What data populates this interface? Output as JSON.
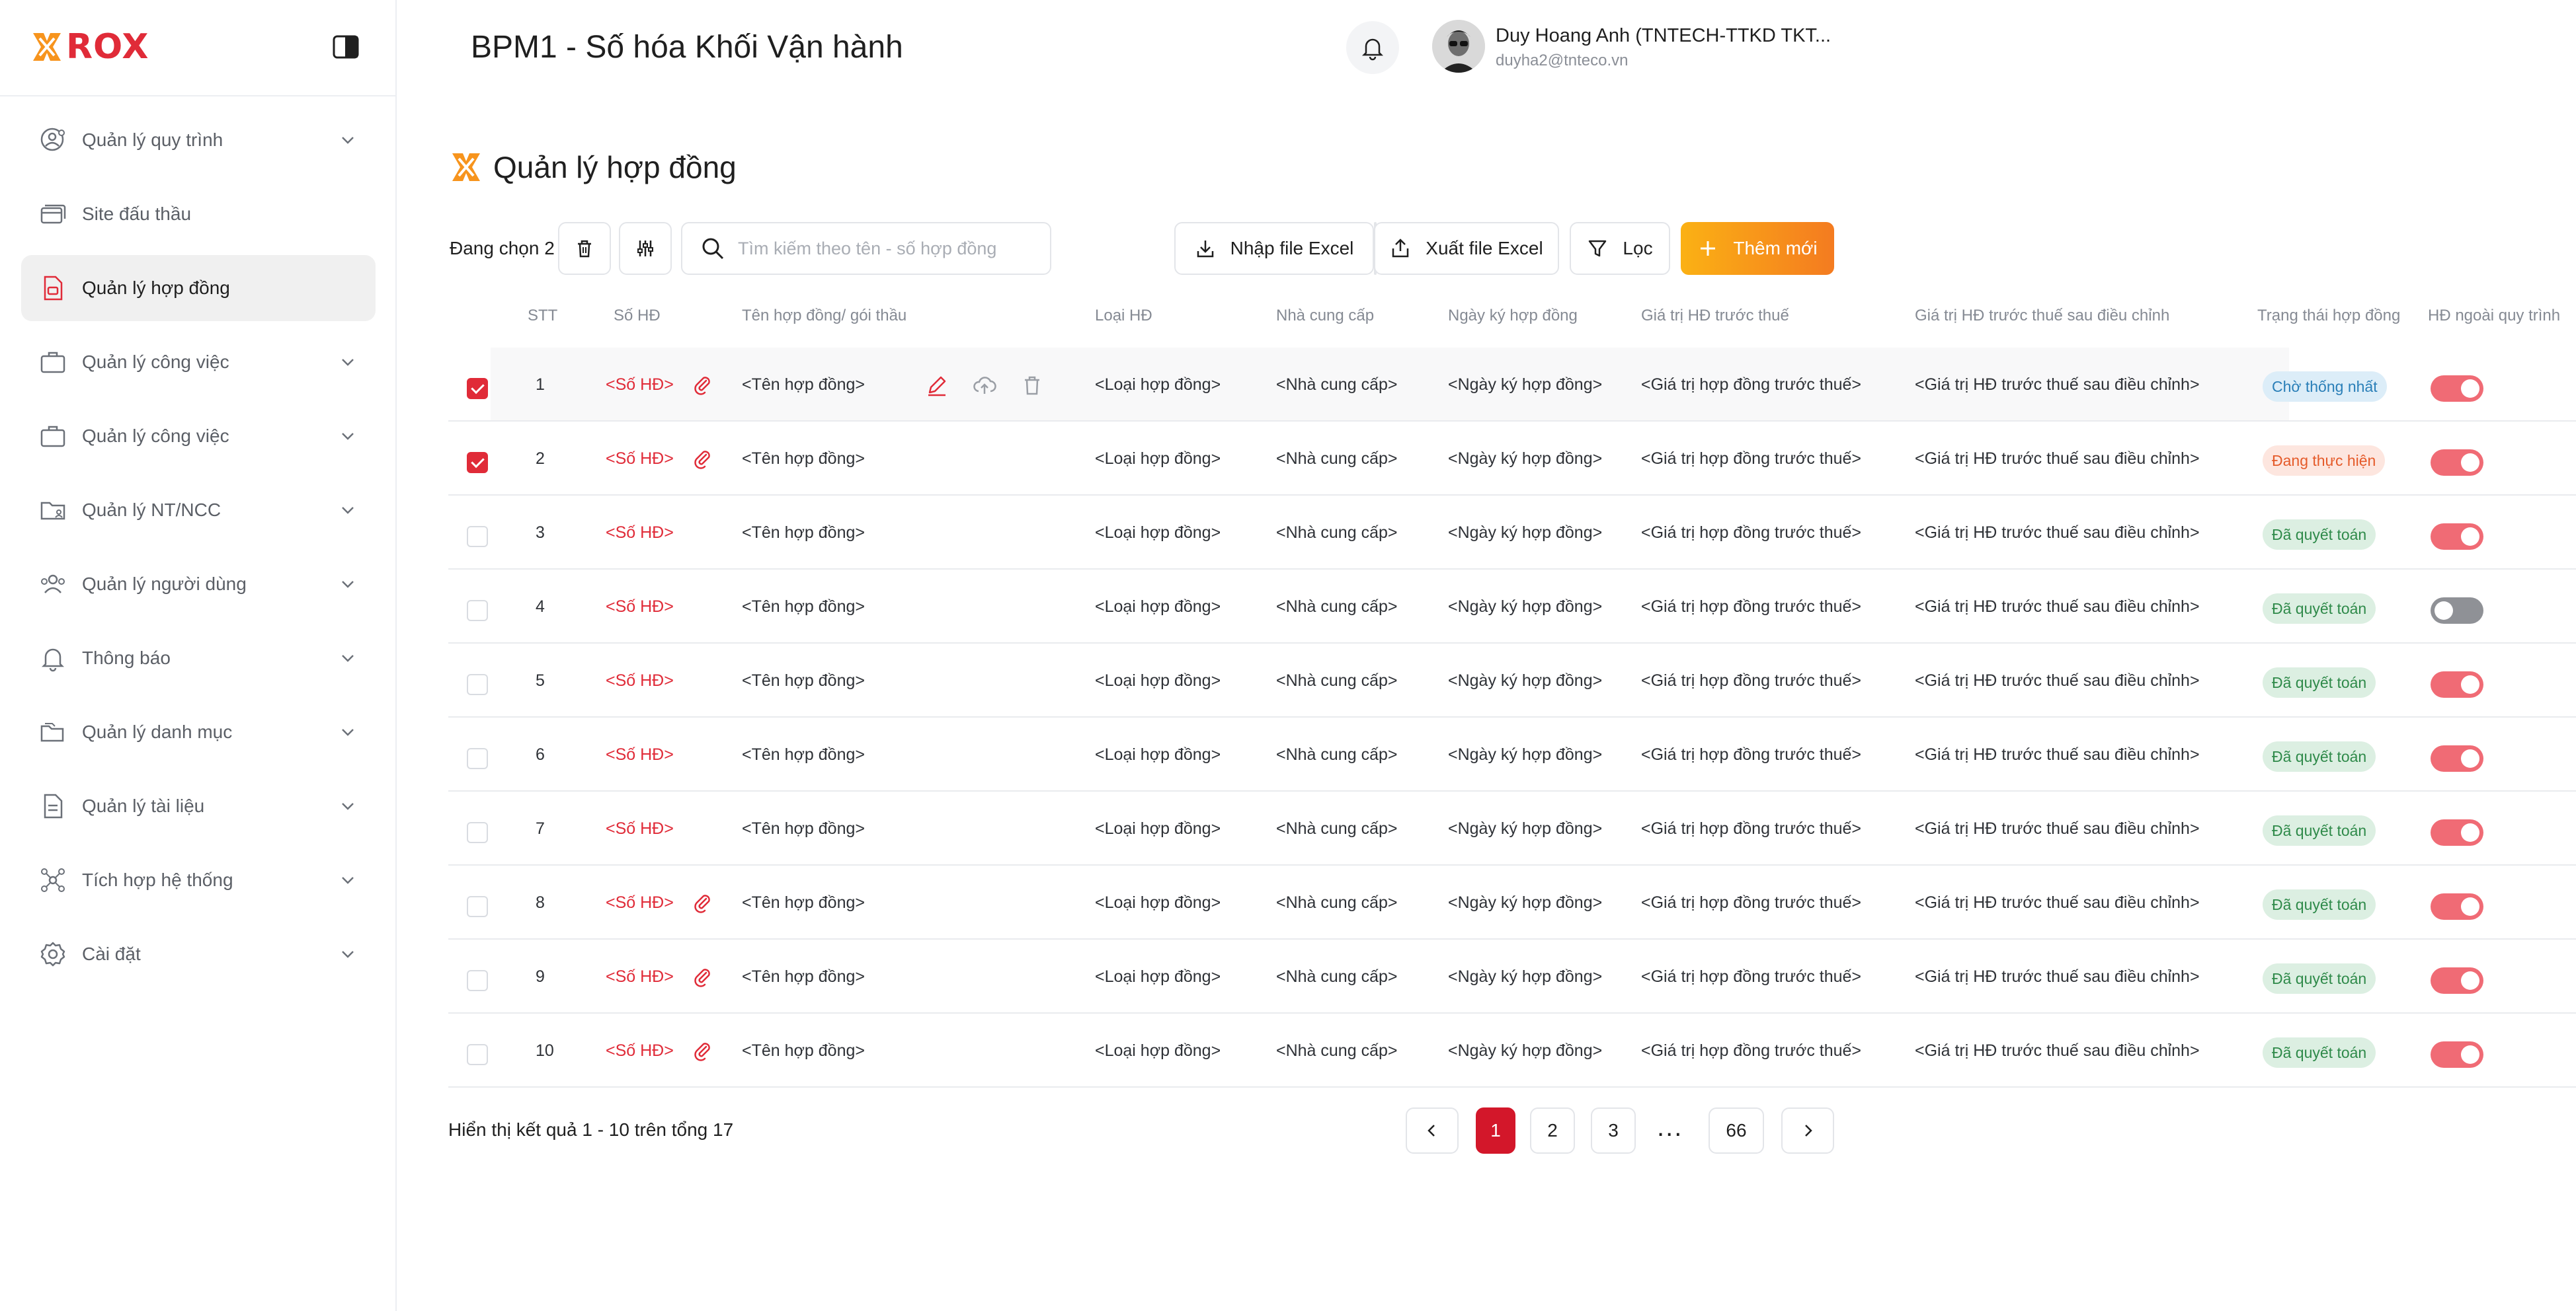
{
  "brand": {
    "name": "ROX",
    "color": "#e02b38"
  },
  "sidebar": {
    "items": [
      {
        "label": "Quản lý quy trình",
        "icon": "user-settings-icon",
        "has_chevron": true
      },
      {
        "label": "Site đấu thầu",
        "icon": "cards-icon",
        "has_chevron": false
      },
      {
        "label": "Quản lý hợp đồng",
        "icon": "contract-file-icon",
        "has_chevron": false,
        "active": true
      },
      {
        "label": "Quản lý công việc",
        "icon": "briefcase-icon",
        "has_chevron": true
      },
      {
        "label": "Quản lý công việc",
        "icon": "briefcase-icon",
        "has_chevron": true
      },
      {
        "label": "Quản lý NT/NCC",
        "icon": "folder-user-icon",
        "has_chevron": true
      },
      {
        "label": "Quản lý người dùng",
        "icon": "users-icon",
        "has_chevron": true
      },
      {
        "label": "Thông báo",
        "icon": "bell-icon",
        "has_chevron": true
      },
      {
        "label": "Quản lý danh mục",
        "icon": "folders-icon",
        "has_chevron": true
      },
      {
        "label": "Quản lý tài liệu",
        "icon": "document-icon",
        "has_chevron": true
      },
      {
        "label": "Tích hợp hệ thống",
        "icon": "integration-icon",
        "has_chevron": true
      },
      {
        "label": "Cài đặt",
        "icon": "gear-icon",
        "has_chevron": true
      }
    ]
  },
  "header": {
    "title": "BPM1 - Số hóa Khối Vận hành",
    "user_name": "Duy Hoang Anh (TNTECH-TTKD TKT...",
    "user_email": "duyha2@tnteco.vn"
  },
  "page": {
    "title": "Quản lý hợp đồng",
    "selected_text": "Đang chọn 2",
    "search_placeholder": "Tìm kiếm theo tên - số hợp đồng",
    "import_label": "Nhập file Excel",
    "export_label": "Xuất file Excel",
    "filter_label": "Lọc",
    "add_label": "Thêm mới"
  },
  "table": {
    "columns": [
      "STT",
      "Số HĐ",
      "Tên hợp đồng/ gói thầu",
      "Loại HĐ",
      "Nhà cung cấp",
      "Ngày ký hợp đồng",
      "Giá trị HĐ trước thuế",
      "Giá trị HĐ trước thuế sau điều chỉnh",
      "Trạng thái hợp đồng",
      "HĐ ngoài quy trình"
    ],
    "rows": [
      {
        "stt": "1",
        "so": "<Số HĐ>",
        "ten": "<Tên hợp đồng>",
        "loai": "<Loại hợp đồng>",
        "ncc": "<Nhà cung cấp>",
        "ngay": "<Ngày ký hợp đồng>",
        "gt": "<Giá trị hợp đồng trước thuế>",
        "gt_dc": "<Giá trị HĐ trước thuế sau điều chỉnh>",
        "status": "Chờ thống nhất",
        "status_type": "wait",
        "checked": true,
        "attach": true,
        "toggle": true,
        "actions": true
      },
      {
        "stt": "2",
        "so": "<Số HĐ>",
        "ten": "<Tên hợp đồng>",
        "loai": "<Loại hợp đồng>",
        "ncc": "<Nhà cung cấp>",
        "ngay": "<Ngày ký hợp đồng>",
        "gt": "<Giá trị hợp đồng trước thuế>",
        "gt_dc": "<Giá trị HĐ trước thuế sau điều chỉnh>",
        "status": "Đang thực hiện",
        "status_type": "doing",
        "checked": true,
        "attach": true,
        "toggle": true
      },
      {
        "stt": "3",
        "so": "<Số HĐ>",
        "ten": "<Tên hợp đồng>",
        "loai": "<Loại hợp đồng>",
        "ncc": "<Nhà cung cấp>",
        "ngay": "<Ngày ký hợp đồng>",
        "gt": "<Giá trị hợp đồng trước thuế>",
        "gt_dc": "<Giá trị HĐ trước thuế sau điều chỉnh>",
        "status": "Đã quyết toán",
        "status_type": "done",
        "checked": false,
        "attach": false,
        "toggle": true
      },
      {
        "stt": "4",
        "so": "<Số HĐ>",
        "ten": "<Tên hợp đồng>",
        "loai": "<Loại hợp đồng>",
        "ncc": "<Nhà cung cấp>",
        "ngay": "<Ngày ký hợp đồng>",
        "gt": "<Giá trị hợp đồng trước thuế>",
        "gt_dc": "<Giá trị HĐ trước thuế sau điều chỉnh>",
        "status": "Đã quyết toán",
        "status_type": "done",
        "checked": false,
        "attach": false,
        "toggle": false
      },
      {
        "stt": "5",
        "so": "<Số HĐ>",
        "ten": "<Tên hợp đồng>",
        "loai": "<Loại hợp đồng>",
        "ncc": "<Nhà cung cấp>",
        "ngay": "<Ngày ký hợp đồng>",
        "gt": "<Giá trị hợp đồng trước thuế>",
        "gt_dc": "<Giá trị HĐ trước thuế sau điều chỉnh>",
        "status": "Đã quyết toán",
        "status_type": "done",
        "checked": false,
        "attach": false,
        "toggle": true
      },
      {
        "stt": "6",
        "so": "<Số HĐ>",
        "ten": "<Tên hợp đồng>",
        "loai": "<Loại hợp đồng>",
        "ncc": "<Nhà cung cấp>",
        "ngay": "<Ngày ký hợp đồng>",
        "gt": "<Giá trị hợp đồng trước thuế>",
        "gt_dc": "<Giá trị HĐ trước thuế sau điều chỉnh>",
        "status": "Đã quyết toán",
        "status_type": "done",
        "checked": false,
        "attach": false,
        "toggle": true
      },
      {
        "stt": "7",
        "so": "<Số HĐ>",
        "ten": "<Tên hợp đồng>",
        "loai": "<Loại hợp đồng>",
        "ncc": "<Nhà cung cấp>",
        "ngay": "<Ngày ký hợp đồng>",
        "gt": "<Giá trị hợp đồng trước thuế>",
        "gt_dc": "<Giá trị HĐ trước thuế sau điều chỉnh>",
        "status": "Đã quyết toán",
        "status_type": "done",
        "checked": false,
        "attach": false,
        "toggle": true
      },
      {
        "stt": "8",
        "so": "<Số HĐ>",
        "ten": "<Tên hợp đồng>",
        "loai": "<Loại hợp đồng>",
        "ncc": "<Nhà cung cấp>",
        "ngay": "<Ngày ký hợp đồng>",
        "gt": "<Giá trị hợp đồng trước thuế>",
        "gt_dc": "<Giá trị HĐ trước thuế sau điều chỉnh>",
        "status": "Đã quyết toán",
        "status_type": "done",
        "checked": false,
        "attach": true,
        "toggle": true
      },
      {
        "stt": "9",
        "so": "<Số HĐ>",
        "ten": "<Tên hợp đồng>",
        "loai": "<Loại hợp đồng>",
        "ncc": "<Nhà cung cấp>",
        "ngay": "<Ngày ký hợp đồng>",
        "gt": "<Giá trị hợp đồng trước thuế>",
        "gt_dc": "<Giá trị HĐ trước thuế sau điều chỉnh>",
        "status": "Đã quyết toán",
        "status_type": "done",
        "checked": false,
        "attach": true,
        "toggle": true
      },
      {
        "stt": "10",
        "so": "<Số HĐ>",
        "ten": "<Tên hợp đồng>",
        "loai": "<Loại hợp đồng>",
        "ncc": "<Nhà cung cấp>",
        "ngay": "<Ngày ký hợp đồng>",
        "gt": "<Giá trị hợp đồng trước thuế>",
        "gt_dc": "<Giá trị HĐ trước thuế sau điều chỉnh>",
        "status": "Đã quyết toán",
        "status_type": "done",
        "checked": false,
        "attach": true,
        "toggle": true
      }
    ]
  },
  "footer": {
    "result_text": "Hiển thị kết quả 1 - 10 trên tổng 17",
    "pages": [
      "1",
      "2",
      "3",
      "66"
    ],
    "current_page": "1",
    "ellipsis": "..."
  },
  "colors": {
    "accent": "#e02b38",
    "primary_button_from": "#fbb114",
    "primary_button_to": "#f47b20",
    "active_page": "#d3172a"
  }
}
